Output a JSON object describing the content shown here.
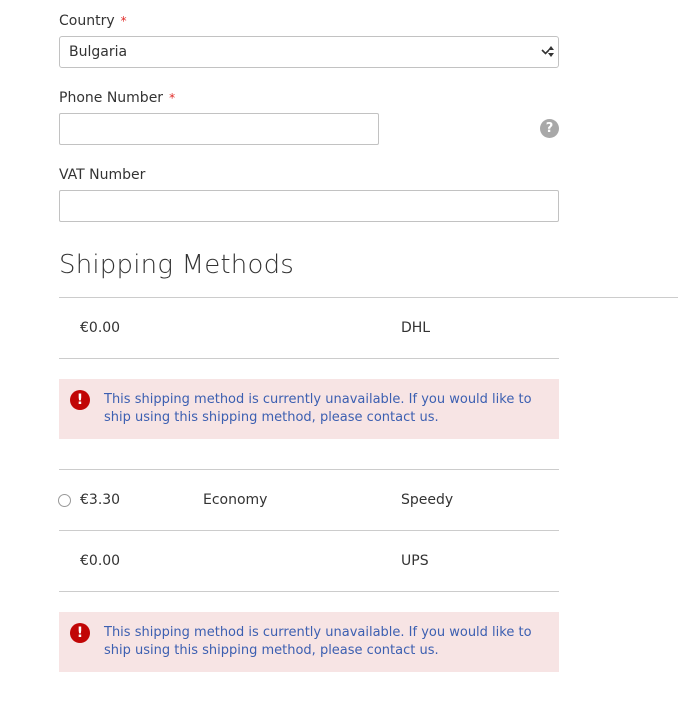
{
  "country": {
    "label": "Country",
    "required_mark": "*",
    "selected": "Bulgaria"
  },
  "phone": {
    "label": "Phone Number",
    "required_mark": "*",
    "value": "",
    "help_glyph": "?"
  },
  "vat": {
    "label": "VAT Number",
    "value": ""
  },
  "shipping": {
    "title": "Shipping Methods",
    "methods": [
      {
        "price": "€0.00",
        "method": "",
        "carrier": "DHL",
        "selectable": false
      },
      {
        "price": "€3.30",
        "method": "Economy",
        "carrier": "Speedy",
        "selectable": true
      },
      {
        "price": "€0.00",
        "method": "",
        "carrier": "UPS",
        "selectable": false
      }
    ],
    "errors": [
      {
        "icon": "!",
        "text": "This shipping method is currently unavailable. If you would like to ship using this shipping method, please contact us."
      },
      {
        "icon": "!",
        "text": "This shipping method is currently unavailable. If you would like to ship using this shipping method, please contact us."
      }
    ]
  },
  "icons": {
    "select_arrows": "select-arrows-icon",
    "help": "question-mark-icon",
    "error": "exclamation-icon"
  },
  "colors": {
    "required": "#e02b27",
    "error_background": "#f7e4e4",
    "error_icon": "#c10606",
    "error_text": "#3c5fb1"
  }
}
